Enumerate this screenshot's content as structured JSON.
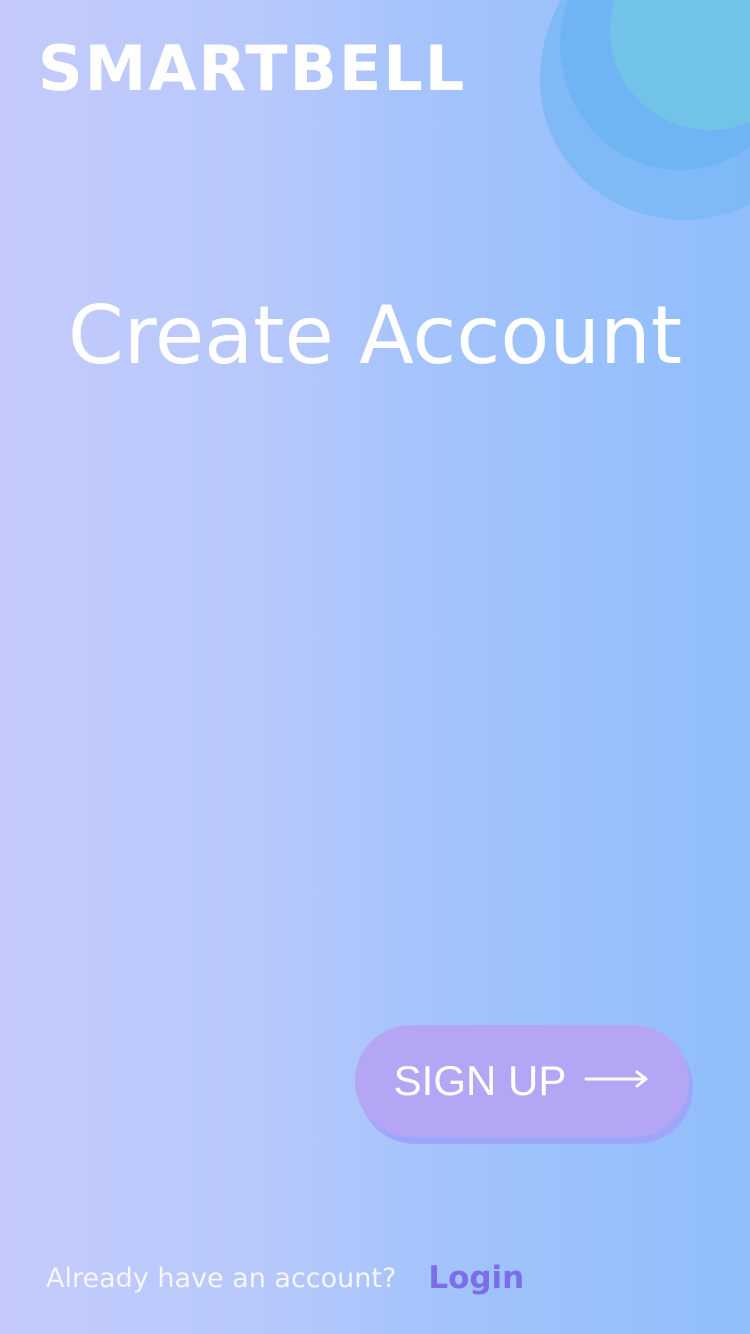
{
  "brand": {
    "logo_text": "SMARTBELL"
  },
  "page": {
    "title": "Create Account"
  },
  "actions": {
    "signup_label": "SIGN UP",
    "signup_icon": "arrow-right-icon"
  },
  "footer": {
    "prompt": "Already have an account?",
    "login_label": "Login"
  },
  "colors": {
    "background_left": "#c4cbfb",
    "background_right": "#8fbefc",
    "button": "#b5a6f5",
    "login_link": "#7b6ee8"
  }
}
